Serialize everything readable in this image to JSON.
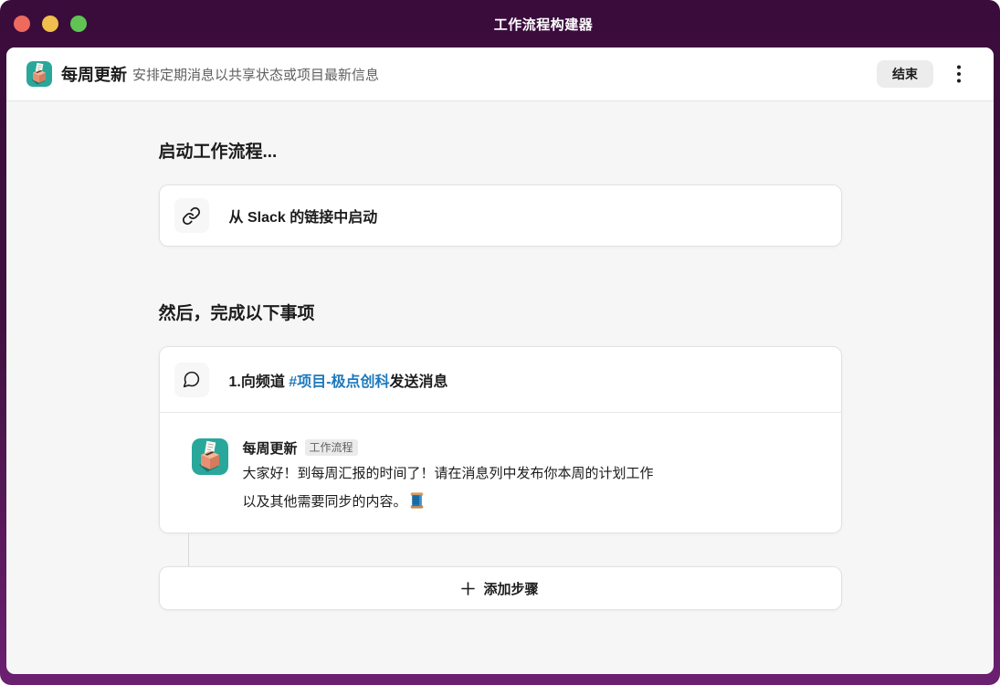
{
  "titlebar": {
    "title": "工作流程构建器"
  },
  "header": {
    "app_name": "每周更新",
    "subtitle": "安排定期消息以共享状态或项目最新信息",
    "finish_label": "结束"
  },
  "trigger": {
    "heading": "启动工作流程...",
    "card_label": "从 Slack 的链接中启动"
  },
  "steps": {
    "heading": "然后，完成以下事项",
    "step1": {
      "title_prefix": "1.向频道 ",
      "channel_link": "#项目-极点创科",
      "title_suffix": "发送消息",
      "message": {
        "sender": "每周更新",
        "sender_badge": "工作流程",
        "line1": "大家好！到每周汇报的时间了！请在消息列中发布你本周的计划工作",
        "line2": "以及其他需要同步的内容。"
      }
    },
    "add_step_label": "添加步骤"
  },
  "icons": {
    "app_icon": "ballot-box-on-teal",
    "trigger_icon": "chain-link",
    "step_icon": "message-bubble",
    "menu_icon": "kebab-vertical",
    "add_icon": "plus",
    "message_emoji": "spool-of-thread"
  },
  "colors": {
    "frame_top": "#3a0c3c",
    "frame_bottom": "#6b2070",
    "canvas": "#f6f6f6",
    "link_blue": "#1d79bc",
    "app_teal": "#2aa79b",
    "traffic_red": "#ee6a5e",
    "traffic_yellow": "#f0bf4c",
    "traffic_green": "#5fc454"
  }
}
